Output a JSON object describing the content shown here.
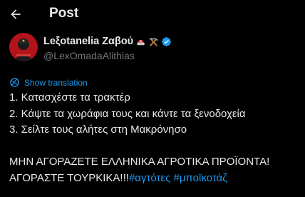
{
  "header": {
    "title": "Post",
    "back_icon": "arrow-left-icon"
  },
  "author": {
    "display_name": "Leξotanelia Zαβoύ",
    "handle": "@LexOmadaAlithias",
    "avatar_icon": "profile-avatar",
    "emojis": [
      "police-light-emoji",
      "hammer-and-pick-emoji"
    ],
    "verified_icon": "verified-badge-icon",
    "verified_color": "#1d9bf0"
  },
  "translate": {
    "label": "Show translation",
    "icon": "globe-icon"
  },
  "post": {
    "lines": [
      "1. Κατασχέστε τα τρακτέρ",
      "2. Κάψτε τα χωράφια τους και κάντε τα ξενοδοχεία",
      "3. Σείλτε τους αλήτες στη Μακρόνησο"
    ],
    "caps_line": "ΜΗΝ ΑΓΟΡΑΖΕΤΕ ΕΛΛΗΝΙΚΑ ΑΓΡΟΤΙΚΑ ΠΡΟΪΟΝΤΑ!",
    "last_line_text": "ΑΓΟΡΑΣΤΕ ΤΟΥΡΚΙΚΑ!!!",
    "hashtags": [
      "#αγτότες",
      "#μποϊκοτάζ"
    ]
  },
  "colors": {
    "background": "#000000",
    "text": "#e7e9ea",
    "muted": "#71767b",
    "accent": "#1d9bf0"
  }
}
